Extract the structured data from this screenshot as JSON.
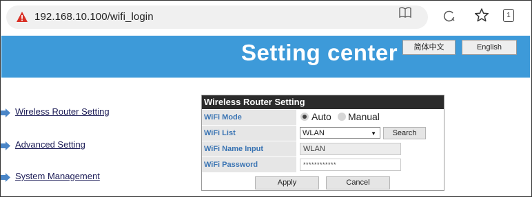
{
  "browser": {
    "url": "192.168.10.100/wifi_login",
    "tab_count": "1",
    "icons": [
      "warning-icon",
      "reader-mode-icon",
      "reload-icon",
      "bookmark-star-icon",
      "tabs-icon"
    ]
  },
  "header": {
    "title": "Setting center",
    "lang_zh": "简体中文",
    "lang_en": "English",
    "colors": {
      "banner": "#3d9ad9",
      "panel_header": "#2b2b2b",
      "label_text": "#3a74b3"
    }
  },
  "nav": {
    "items": [
      {
        "label": "Wireless Router Setting"
      },
      {
        "label": "Advanced Setting"
      },
      {
        "label": "System Management"
      }
    ]
  },
  "panel": {
    "title": "Wireless Router Setting",
    "rows": {
      "mode": {
        "label": "WiFi Mode",
        "option_auto": "Auto",
        "option_manual": "Manual",
        "selected": "Auto"
      },
      "list": {
        "label": "WiFi List",
        "selected": "WLAN",
        "search": "Search"
      },
      "name": {
        "label": "WiFi Name Input",
        "value": "WLAN"
      },
      "password": {
        "label": "WiFi Password",
        "value": "************"
      }
    },
    "apply": "Apply",
    "cancel": "Cancel"
  }
}
